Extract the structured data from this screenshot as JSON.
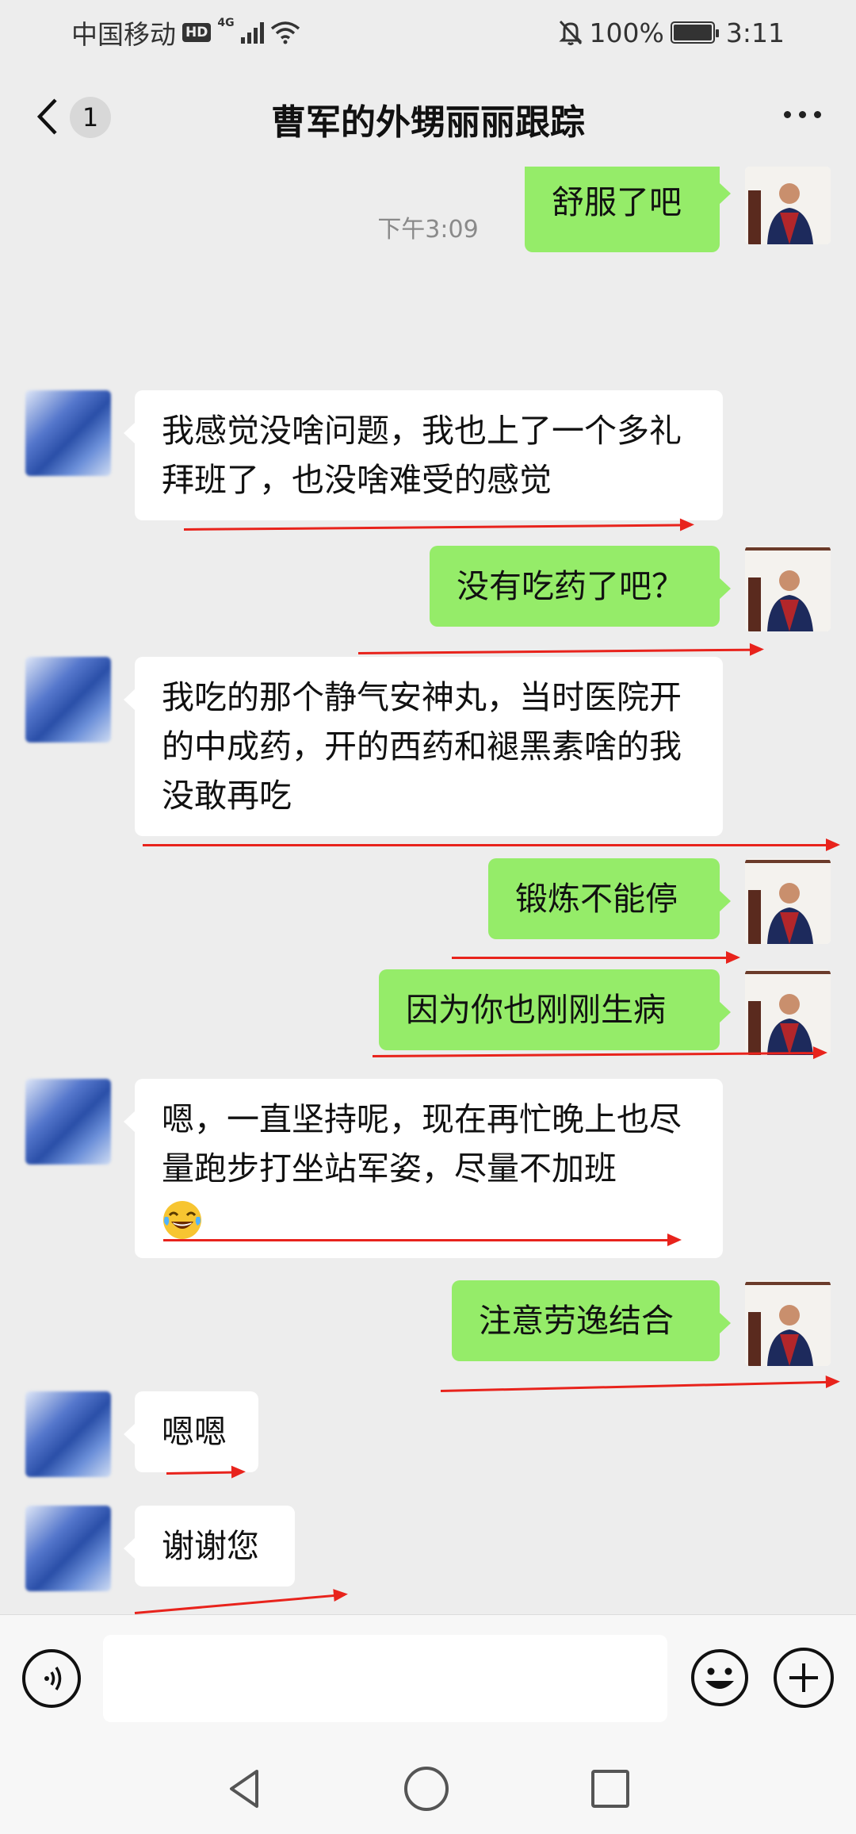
{
  "status_bar": {
    "carrier": "中国移动",
    "hd": "HD",
    "network": "4G",
    "battery": "100%",
    "time": "3:11"
  },
  "header": {
    "unread_count": "1",
    "title": "曹军的外甥丽丽跟踪"
  },
  "chat": {
    "partial_top_message": "舒服了吧",
    "timestamp": "下午3:09",
    "messages": [
      {
        "from": "other",
        "text": "我感觉没啥问题，我也上了一个多礼拜班了，也没啥难受的感觉"
      },
      {
        "from": "self",
        "text": "没有吃药了吧？"
      },
      {
        "from": "other",
        "text": "我吃的那个静气安神丸，当时医院开的中成药，开的西药和褪黑素啥的我没敢再吃"
      },
      {
        "from": "self",
        "text": "锻炼不能停"
      },
      {
        "from": "self",
        "text": "因为你也刚刚生病"
      },
      {
        "from": "other",
        "text": "嗯，一直坚持呢，现在再忙晚上也尽量跑步打坐站军姿，尽量不加班",
        "emoji": "face-with-tears-of-joy"
      },
      {
        "from": "self",
        "text": "注意劳逸结合"
      },
      {
        "from": "other",
        "text": "嗯嗯"
      },
      {
        "from": "other",
        "text": "谢谢您"
      }
    ]
  },
  "input_bar": {
    "placeholder": ""
  },
  "colors": {
    "background": "#ededed",
    "self_bubble": "#95ec69",
    "other_bubble": "#ffffff",
    "annotation_red": "#e8231c"
  },
  "icons": [
    "back-arrow-icon",
    "more-icon",
    "voice-icon",
    "emoji-icon",
    "plus-icon",
    "nav-back-icon",
    "nav-home-icon",
    "nav-recent-icon",
    "signal-icon",
    "wifi-icon",
    "mute-icon",
    "battery-icon"
  ]
}
